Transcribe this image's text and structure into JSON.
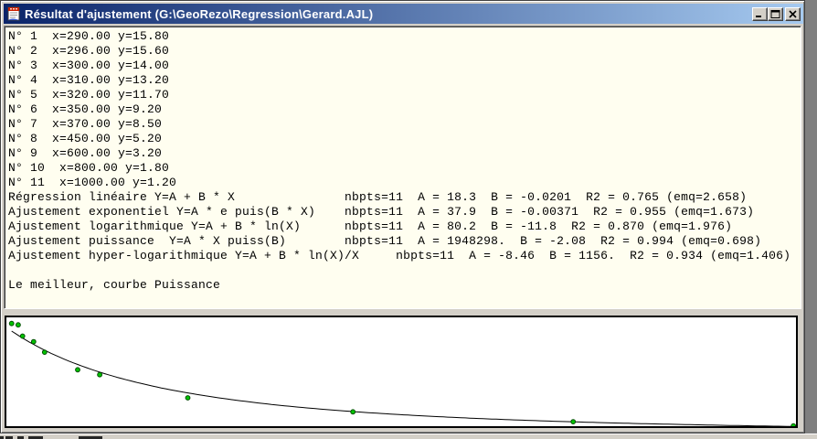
{
  "window": {
    "title": "Résultat d'ajustement (G:\\GeoRezo\\Regression\\Gerard.AJL)",
    "icon_name": "document-icon",
    "controls": {
      "minimize": "minimize-icon",
      "maximize": "maximize-icon",
      "close": "close-icon"
    },
    "titlebar_gradient": [
      "#0a246a",
      "#a6caf0"
    ]
  },
  "output": {
    "lines": [
      "N° 1  x=290.00 y=15.80",
      "N° 2  x=296.00 y=15.60",
      "N° 3  x=300.00 y=14.00",
      "N° 4  x=310.00 y=13.20",
      "N° 5  x=320.00 y=11.70",
      "N° 6  x=350.00 y=9.20",
      "N° 7  x=370.00 y=8.50",
      "N° 8  x=450.00 y=5.20",
      "N° 9  x=600.00 y=3.20",
      "N° 10  x=800.00 y=1.80",
      "N° 11  x=1000.00 y=1.20",
      "Régression linéaire Y=A + B * X               nbpts=11  A = 18.3  B = -0.0201  R2 = 0.765 (emq=2.658)",
      "Ajustement exponentiel Y=A * e puis(B * X)    nbpts=11  A = 37.9  B = -0.00371  R2 = 0.955 (emq=1.673)",
      "Ajustement logarithmique Y=A + B * ln(X)      nbpts=11  A = 80.2  B = -11.8  R2 = 0.870 (emq=1.976)",
      "Ajustement puissance  Y=A * X puiss(B)        nbpts=11  A = 1948298.  B = -2.08  R2 = 0.994 (emq=0.698)",
      "Ajustement hyper-logarithmique Y=A + B * ln(X)/X     nbpts=11  A = -8.46  B = 1156.  R2 = 0.934 (emq=1.406)",
      "",
      "Le meilleur, courbe Puissance"
    ]
  },
  "chart_data": {
    "type": "scatter",
    "title": "",
    "xlabel": "",
    "ylabel": "",
    "x": [
      290,
      296,
      300,
      310,
      320,
      350,
      370,
      450,
      600,
      800,
      1000
    ],
    "y": [
      15.8,
      15.6,
      14.0,
      13.2,
      11.7,
      9.2,
      8.5,
      5.2,
      3.2,
      1.8,
      1.2
    ],
    "fit_curve": {
      "type": "power",
      "label": "Puissance",
      "formula": "Y=A * X puiss(B)",
      "A": 1948298,
      "B": -2.08,
      "x_start": 290,
      "x_end": 1002
    },
    "xlim": [
      285.3,
      1002.3
    ],
    "ylim": [
      1.16,
      16.67
    ],
    "grid": false,
    "legend": null,
    "point_color": "#00c400",
    "point_edge_color": "#004d00",
    "curve_color": "#000000",
    "background": "#ffffff"
  },
  "colors": {
    "window_bg": "#d4d0c8",
    "text_area_bg": "#fffef0",
    "title_text": "#ffffff",
    "backdrop": "#7f7f7f"
  }
}
